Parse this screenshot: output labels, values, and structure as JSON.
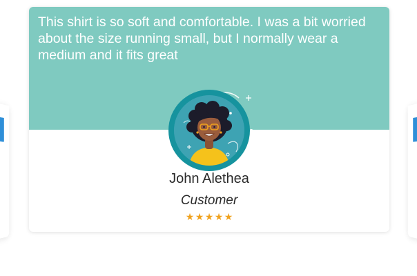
{
  "testimonial": {
    "quote": "This shirt is so soft and comfortable. I was a bit worried about the size running small, but I normally wear a medium and it fits great",
    "name": "John Alethea",
    "role": "Customer",
    "rating": 5,
    "rating_max": 5
  },
  "icons": {
    "avatar": "woman-with-glasses-avatar",
    "star": "star-icon"
  },
  "colors": {
    "header_background": "#7fcac0",
    "avatar_ring": "#16939e",
    "star": "#f0a21e",
    "quote_text": "#ffffff",
    "side_accent": "#2f8fd8"
  }
}
